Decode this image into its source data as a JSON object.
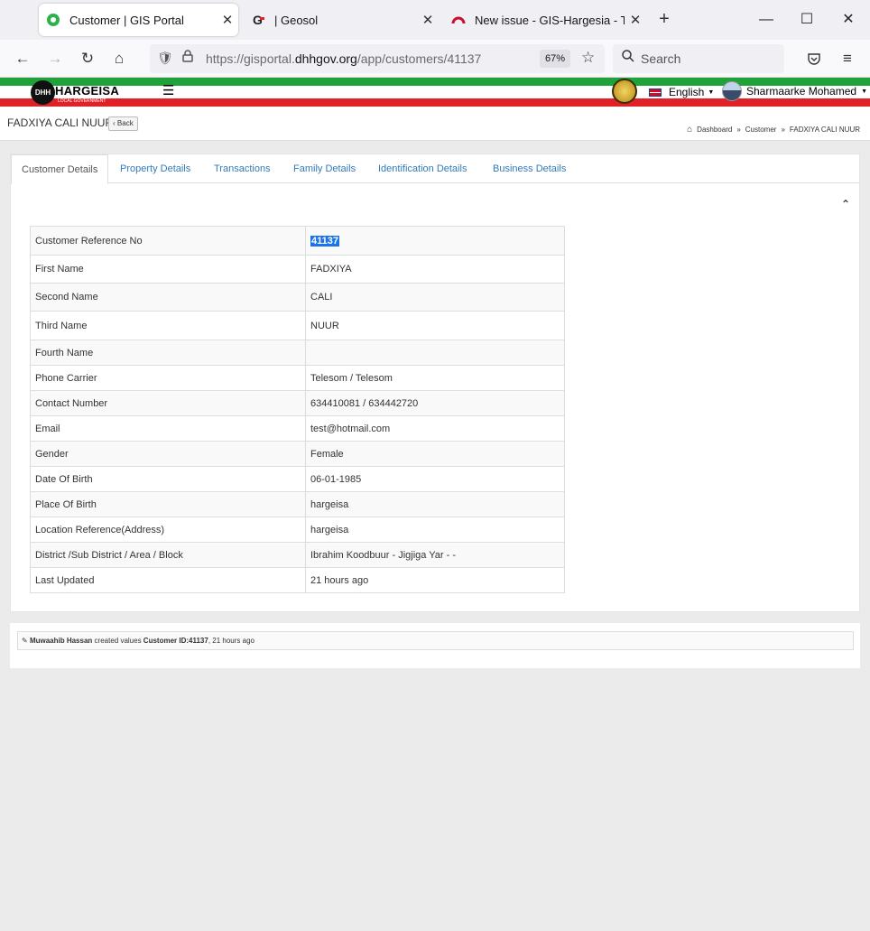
{
  "browser": {
    "tabs": [
      {
        "title": "Customer | GIS Portal",
        "active": true
      },
      {
        "title": "| Geosol",
        "active": false
      },
      {
        "title": "New issue - GIS-Hargesia - Team",
        "active": false
      }
    ],
    "url_prefix": "https://gisportal.",
    "url_host": "dhhgov.org",
    "url_path": "/app/customers/41137",
    "zoom": "67%",
    "search_placeholder": "Search"
  },
  "header": {
    "brand": "HARGEISA",
    "brand_sub": "LOCAL GOVERNMENT",
    "language": "English",
    "user": "Sharmaarke Mohamed",
    "colors": {
      "green": "#1fa23a",
      "red": "#e02128"
    }
  },
  "page": {
    "title": "FADXIYA CALI NUUR",
    "back_label": "Back",
    "breadcrumbs": [
      "Dashboard",
      "Customer",
      "FADXIYA CALI NUUR"
    ]
  },
  "tabs": [
    "Customer Details",
    "Property Details",
    "Transactions",
    "Family Details",
    "Identification Details",
    "Business Details"
  ],
  "details": [
    {
      "label": "Customer Reference No",
      "value": "41137"
    },
    {
      "label": "First Name",
      "value": "FADXIYA"
    },
    {
      "label": "Second Name",
      "value": "CALI"
    },
    {
      "label": "Third Name",
      "value": "NUUR"
    },
    {
      "label": "Fourth Name",
      "value": ""
    },
    {
      "label": "Phone Carrier",
      "value": "Telesom / Telesom"
    },
    {
      "label": "Contact Number",
      "value": "634410081 / 634442720"
    },
    {
      "label": "Email",
      "value": "test@hotmail.com"
    },
    {
      "label": "Gender",
      "value": "Female"
    },
    {
      "label": "Date Of Birth",
      "value": "06-01-1985"
    },
    {
      "label": "Place Of Birth",
      "value": "hargeisa"
    },
    {
      "label": "Location Reference(Address)",
      "value": "hargeisa"
    },
    {
      "label": "District /Sub District / Area / Block",
      "value": "Ibrahim Koodbuur - Jigjiga Yar - -"
    },
    {
      "label": "Last Updated",
      "value": "21 hours ago"
    }
  ],
  "activity": {
    "user": "Muwaahib Hassan",
    "action": "created values",
    "subject": "Customer ID:41137",
    "time": ", 21 hours ago"
  }
}
